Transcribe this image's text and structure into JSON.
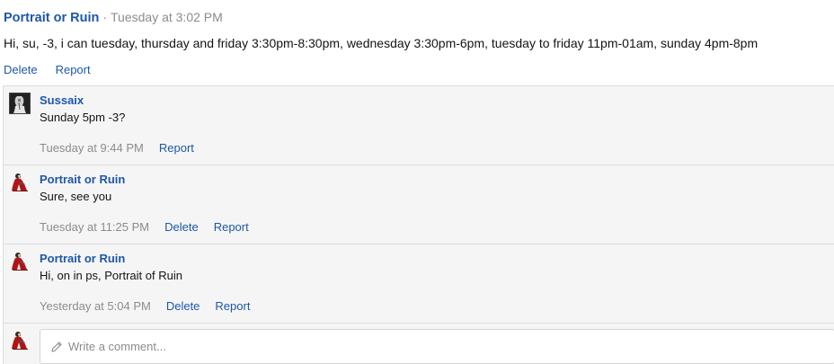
{
  "post": {
    "author": "Portrait or Ruin",
    "separator": "·",
    "time": "Tuesday at 3:02 PM",
    "message": "Hi, su, -3, i can tuesday, thursday and friday 3:30pm-8:30pm, wednesday 3:30pm-6pm, tuesday to friday 11pm-01am, sunday 4pm-8pm",
    "actions": {
      "delete": "Delete",
      "report": "Report"
    }
  },
  "comments": [
    {
      "author": "Sussaix",
      "avatar_icon": "sketch-portrait-avatar",
      "text": "Sunday 5pm -3?",
      "time": "Tuesday at 9:44 PM",
      "report": "Report"
    },
    {
      "author": "Portrait or Ruin",
      "avatar_icon": "red-figure-avatar",
      "text": "Sure, see you",
      "time": "Tuesday at 11:25 PM",
      "delete": "Delete",
      "report": "Report"
    },
    {
      "author": "Portrait or Ruin",
      "avatar_icon": "red-figure-avatar",
      "text": "Hi, on in ps, Portrait of Ruin",
      "time": "Yesterday at 5:04 PM",
      "delete": "Delete",
      "report": "Report"
    }
  ],
  "reply": {
    "avatar_icon": "red-figure-avatar",
    "placeholder": "Write a comment..."
  },
  "colors": {
    "link": "#1d57a8",
    "muted": "#8c8c8c",
    "comment_bg": "#f5f5f5",
    "border": "#dcdcdc"
  }
}
